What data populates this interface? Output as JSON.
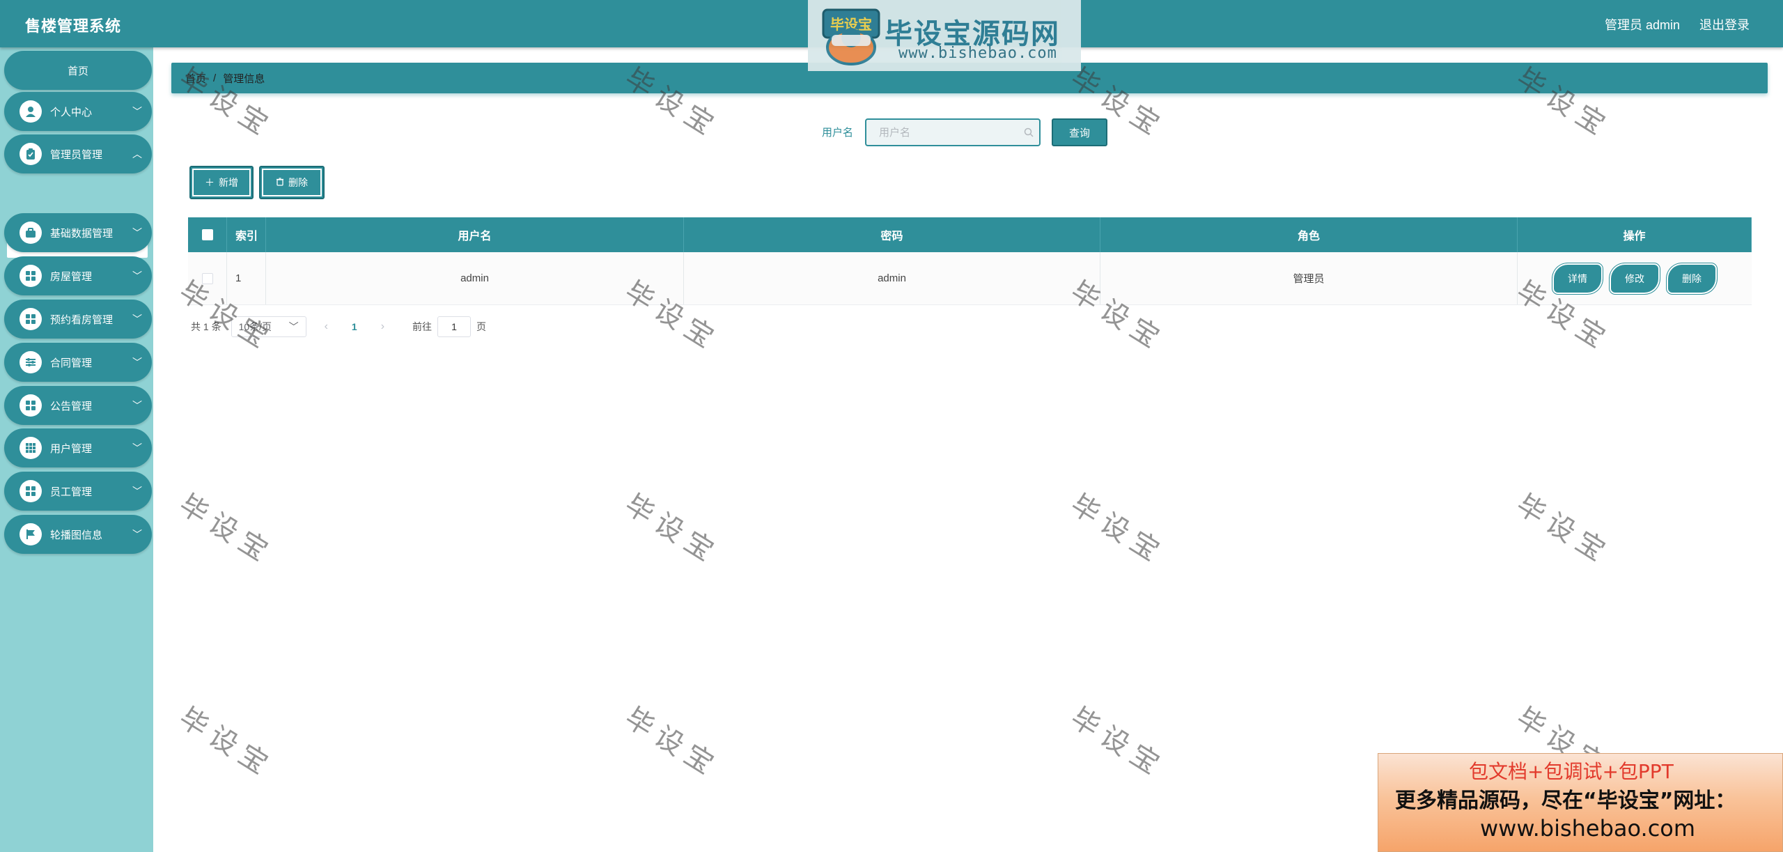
{
  "app": {
    "title": "售楼管理系统"
  },
  "header": {
    "user_label": "管理员 admin",
    "logout_label": "退出登录"
  },
  "logo_banner": {
    "badge_text": "毕设宝",
    "main_text": "毕设宝源码网",
    "url_text": "www.bishebao.com"
  },
  "sidebar": {
    "home_label": "首页",
    "items": [
      {
        "label": "个人中心",
        "icon": "user-icon"
      },
      {
        "label": "管理员管理",
        "icon": "clipboard-icon"
      },
      {
        "label": "基础数据管理",
        "icon": "briefcase-icon"
      },
      {
        "label": "房屋管理",
        "icon": "grid-icon"
      },
      {
        "label": "预约看房管理",
        "icon": "grid-icon"
      },
      {
        "label": "合同管理",
        "icon": "sliders-icon"
      },
      {
        "label": "公告管理",
        "icon": "grid-icon"
      },
      {
        "label": "用户管理",
        "icon": "dots-grid-icon"
      },
      {
        "label": "员工管理",
        "icon": "grid-icon"
      },
      {
        "label": "轮播图信息",
        "icon": "flag-icon"
      }
    ],
    "sub_item_label": "管理员管理"
  },
  "breadcrumb": {
    "home": "首页",
    "separator": "/",
    "current": "管理信息"
  },
  "search": {
    "label": "用户名",
    "placeholder": "用户名",
    "value": "",
    "query_button": "查询"
  },
  "actions": {
    "add_label": "新增",
    "delete_label": "删除"
  },
  "table": {
    "headers": {
      "index": "索引",
      "username": "用户名",
      "password": "密码",
      "role": "角色",
      "operation": "操作"
    },
    "rows": [
      {
        "index": "1",
        "username": "admin",
        "password": "admin",
        "role": "管理员",
        "checked": false
      }
    ],
    "row_buttons": {
      "detail": "详情",
      "edit": "修改",
      "delete": "删除"
    }
  },
  "pagination": {
    "total_text": "共 1 条",
    "page_size": "10条/页",
    "current_page": "1",
    "goto_label": "前往",
    "goto_value": "1",
    "page_unit": "页"
  },
  "watermark": {
    "text": "毕设宝"
  },
  "ad": {
    "line1": "包文档+包调试+包PPT",
    "line2": "更多精品源码，尽在“毕设宝”网址：",
    "line3": "www.bishebao.com"
  },
  "colors": {
    "primary": "#2f8f9a",
    "sidebar_bg": "#8fd2d4",
    "breadcrumb_text": "#222222",
    "link": "#2f8f9a"
  }
}
